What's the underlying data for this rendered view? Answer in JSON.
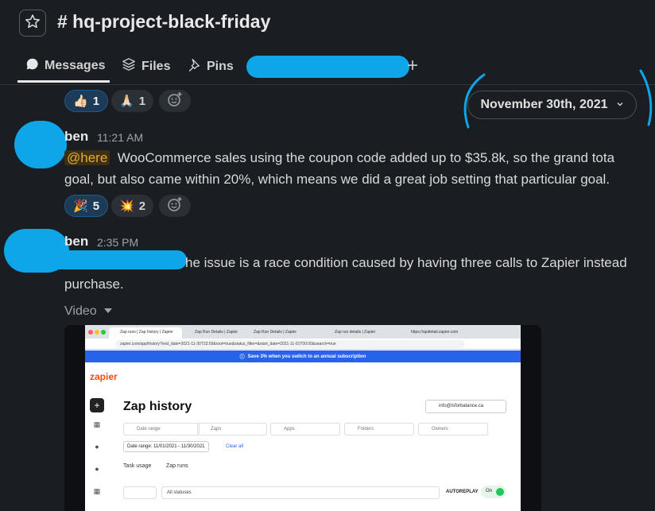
{
  "channel": {
    "title": "# hq-project-black-friday"
  },
  "tabs": [
    {
      "label": "Messages"
    },
    {
      "label": "Files"
    },
    {
      "label": "Pins"
    }
  ],
  "reactions_top": [
    {
      "emoji": "👍🏻",
      "count": "1"
    },
    {
      "emoji": "🙏🏻",
      "count": "1"
    }
  ],
  "date_divider": {
    "label": "November 30th, 2021"
  },
  "message1": {
    "author": "ben",
    "time": "11:21 AM",
    "mention": "@here",
    "line1": "WooCommerce sales using the coupon code added up to $35.8k, so the grand tota",
    "line2": "goal, but also came within 20%, which means we did a great job setting that particular goal.",
    "reactions": [
      {
        "emoji": "🎉",
        "count": "5"
      },
      {
        "emoji": "💥",
        "count": "2"
      }
    ]
  },
  "message2": {
    "author": "ben",
    "time": "2:35 PM",
    "line1": "he issue is a race condition caused by having three calls to Zapier instead",
    "line2": "purchase.",
    "attachment_label": "Video"
  },
  "video": {
    "tabs": [
      "Zap runs | Zap history | Zapier",
      "Zap Run Details | Zapier",
      "Zap Run Details | Zapier",
      "Zap run details | Zapier",
      "https://apidetail.zapier.com"
    ],
    "url": "zapier.com/app/history?end_date=2021-11-30T23:59&root=true&status_filter=&start_date=2021-11-01T00:00&search=true",
    "banner": "Save 3% when you switch to an annual subscription",
    "logo": "zapier",
    "page_title": "Zap history",
    "search_value": "info@lsforbalance.ca",
    "filters": [
      "Date range",
      "Zaps",
      "Apps",
      "Folders",
      "Owners"
    ],
    "date_range": "Date range: 11/01/2021 - 11/30/2021",
    "clear_all": "Clear all",
    "subtabs": [
      "Task usage",
      "Zap runs"
    ],
    "status_select": "All statuses",
    "autoreplay": "AUTOREPLAY",
    "toggle": "On"
  },
  "colors": {
    "background": "#1a1d21",
    "redaction": "#0ea5e9",
    "mention": "#e8a838"
  }
}
